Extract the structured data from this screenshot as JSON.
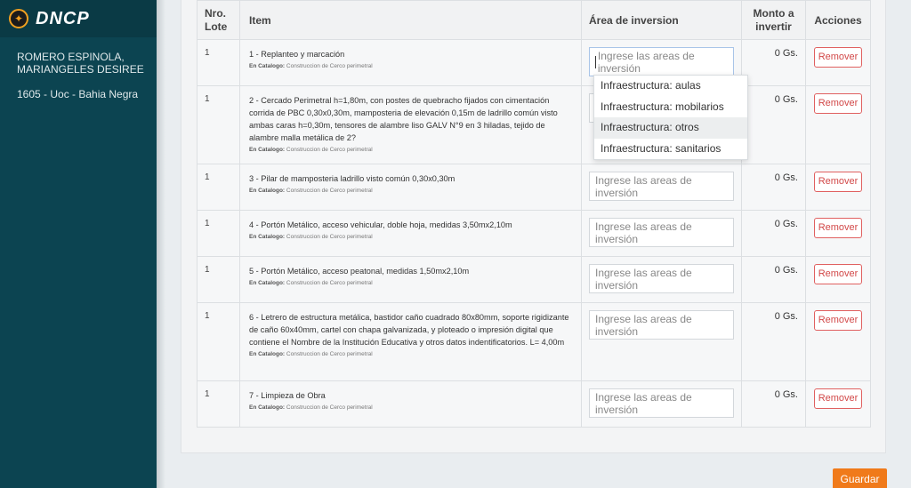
{
  "brand": {
    "name": "DNCP"
  },
  "user": {
    "name": "ROMERO ESPINOLA, MARIANGELES DESIREE",
    "unit": "1605 - Uoc - Bahia Negra"
  },
  "table": {
    "headers": {
      "lote": "Nro. Lote",
      "item": "Item",
      "area": "Área de inversion",
      "monto": "Monto a invertir",
      "acciones": "Acciones"
    },
    "catalog_label": "En Catalogo:",
    "area_placeholder": "Ingrese las areas de inversión",
    "remove_label": "Remover",
    "rows": [
      {
        "lote": "1",
        "desc": "1 - Replanteo y marcación",
        "catalog": "Construccion de Cerco perimetral",
        "monto": "0 Gs."
      },
      {
        "lote": "1",
        "desc": "2 - Cercado Perimetral h=1,80m, con postes de quebracho fijados con cimentación corrida de PBC 0,30x0,30m, mamposteria de elevación 0,15m de ladrillo común visto ambas caras h=0,30m, tensores de alambre liso GALV N°9 en 3 hiladas, tejido de alambre malla metálica de 2?",
        "catalog": "Construccion de Cerco perimetral",
        "monto": "0 Gs."
      },
      {
        "lote": "1",
        "desc": "3 - Pilar de mamposteria ladrillo visto común 0,30x0,30m",
        "catalog": "Construccion de Cerco perimetral",
        "monto": "0 Gs."
      },
      {
        "lote": "1",
        "desc": "4 - Portón Metálico, acceso vehicular, doble hoja, medidas 3,50mx2,10m",
        "catalog": "Construccion de Cerco perimetral",
        "monto": "0 Gs."
      },
      {
        "lote": "1",
        "desc": "5 - Portón Metálico, acceso peatonal, medidas 1,50mx2,10m",
        "catalog": "Construccion de Cerco perimetral",
        "monto": "0 Gs."
      },
      {
        "lote": "1",
        "desc": "6 - Letrero de estructura metálica, bastidor caño cuadrado 80x80mm, soporte rigidizante de caño 60x40mm, cartel con chapa galvanizada, y ploteado o impresión digital que contiene el Nombre de la Institución Educativa y otros datos indentificatorios. L= 4,00m",
        "catalog": "Construccion de Cerco perimetral",
        "monto": "0 Gs."
      },
      {
        "lote": "1",
        "desc": "7 - Limpieza de Obra",
        "catalog": "Construccion de Cerco perimetral",
        "monto": "0 Gs."
      }
    ]
  },
  "dropdown": {
    "options": [
      "Infraestructura: aulas",
      "Infraestructura: mobilarios",
      "Infraestructura: otros",
      "Infraestructura: sanitarios"
    ],
    "highlighted_index": 2
  },
  "save_label": "Guardar",
  "colors": {
    "sidebar": "#0c4451",
    "accent": "#f07a1a",
    "remove": "#d24848"
  }
}
